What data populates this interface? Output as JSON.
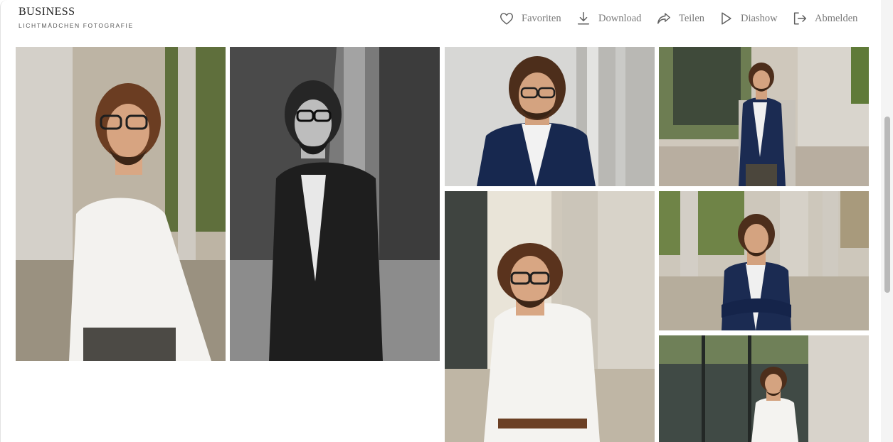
{
  "brand": {
    "title": "BUSINESS",
    "subtitle": "LICHTMÄDCHEN FOTOGRAFIE"
  },
  "nav": {
    "favorites_label": "Favoriten",
    "download_label": "Download",
    "share_label": "Teilen",
    "slideshow_label": "Diashow",
    "logout_label": "Abmelden"
  },
  "icons": {
    "favorites": "heart-icon",
    "download": "download-icon",
    "share": "share-arrow-icon",
    "slideshow": "play-icon",
    "logout": "logout-icon"
  },
  "gallery": {
    "photos": [
      "portrait-white-shirt-pillar",
      "portrait-bw-suit-glass-building",
      "portrait-navy-blazer-closeup",
      "portrait-navy-blazer-full-body",
      "portrait-white-shirt-sunlit-pillars",
      "portrait-arms-crossed-navy-blazer",
      "portrait-white-shirt-glass-facade"
    ]
  },
  "colors": {
    "nav_text": "#7a7a7a",
    "icon_stroke": "#5e5e5e",
    "background": "#ffffff",
    "scrollbar_thumb": "#b9b9b9"
  }
}
